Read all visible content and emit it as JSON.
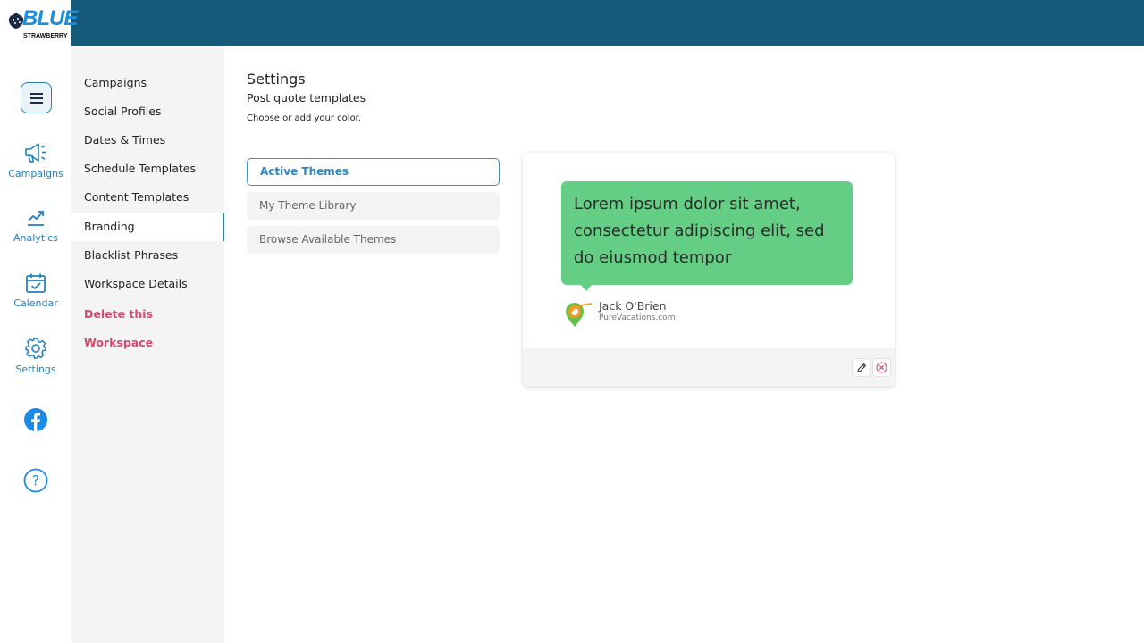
{
  "brand": {
    "logo_top": "BLUE",
    "logo_bottom": "STRAWBERRY"
  },
  "rail": {
    "menu_icon": "hamburger-icon",
    "items": [
      {
        "label": "Campaigns",
        "icon": "megaphone-icon"
      },
      {
        "label": "Analytics",
        "icon": "trend-chart-icon"
      },
      {
        "label": "Calendar",
        "icon": "calendar-check-icon"
      },
      {
        "label": "Settings",
        "icon": "gear-icon"
      },
      {
        "label": "",
        "icon": "facebook-icon"
      },
      {
        "label": "",
        "icon": "help-icon"
      }
    ]
  },
  "subnav": {
    "items": [
      {
        "label": "Campaigns"
      },
      {
        "label": "Social Profiles"
      },
      {
        "label": "Dates & Times"
      },
      {
        "label": "Schedule Templates"
      },
      {
        "label": "Content Templates"
      },
      {
        "label": "Branding",
        "active": true
      },
      {
        "label": "Blacklist Phrases"
      },
      {
        "label": "Workspace Details"
      }
    ],
    "delete_label": "Delete this Workspace"
  },
  "page": {
    "title": "Settings",
    "subtitle": "Post quote templates",
    "hint": "Choose or add your color."
  },
  "tabs": [
    {
      "label": "Active Themes",
      "active": true
    },
    {
      "label": "My Theme Library"
    },
    {
      "label": "Browse Available Themes"
    }
  ],
  "theme_card": {
    "quote": "Lorem ipsum dolor sit amet, consectetur adipiscing elit, sed do eiusmod tempor",
    "author_name": "Jack O'Brien",
    "author_site": "PureVacations.com",
    "bubble_color": "#64ce84",
    "actions": [
      "edit-pencil-icon",
      "remove-circle-icon"
    ]
  },
  "colors": {
    "topbar": "#155a78",
    "accent": "#2a85c4",
    "danger": "#d6496f"
  }
}
